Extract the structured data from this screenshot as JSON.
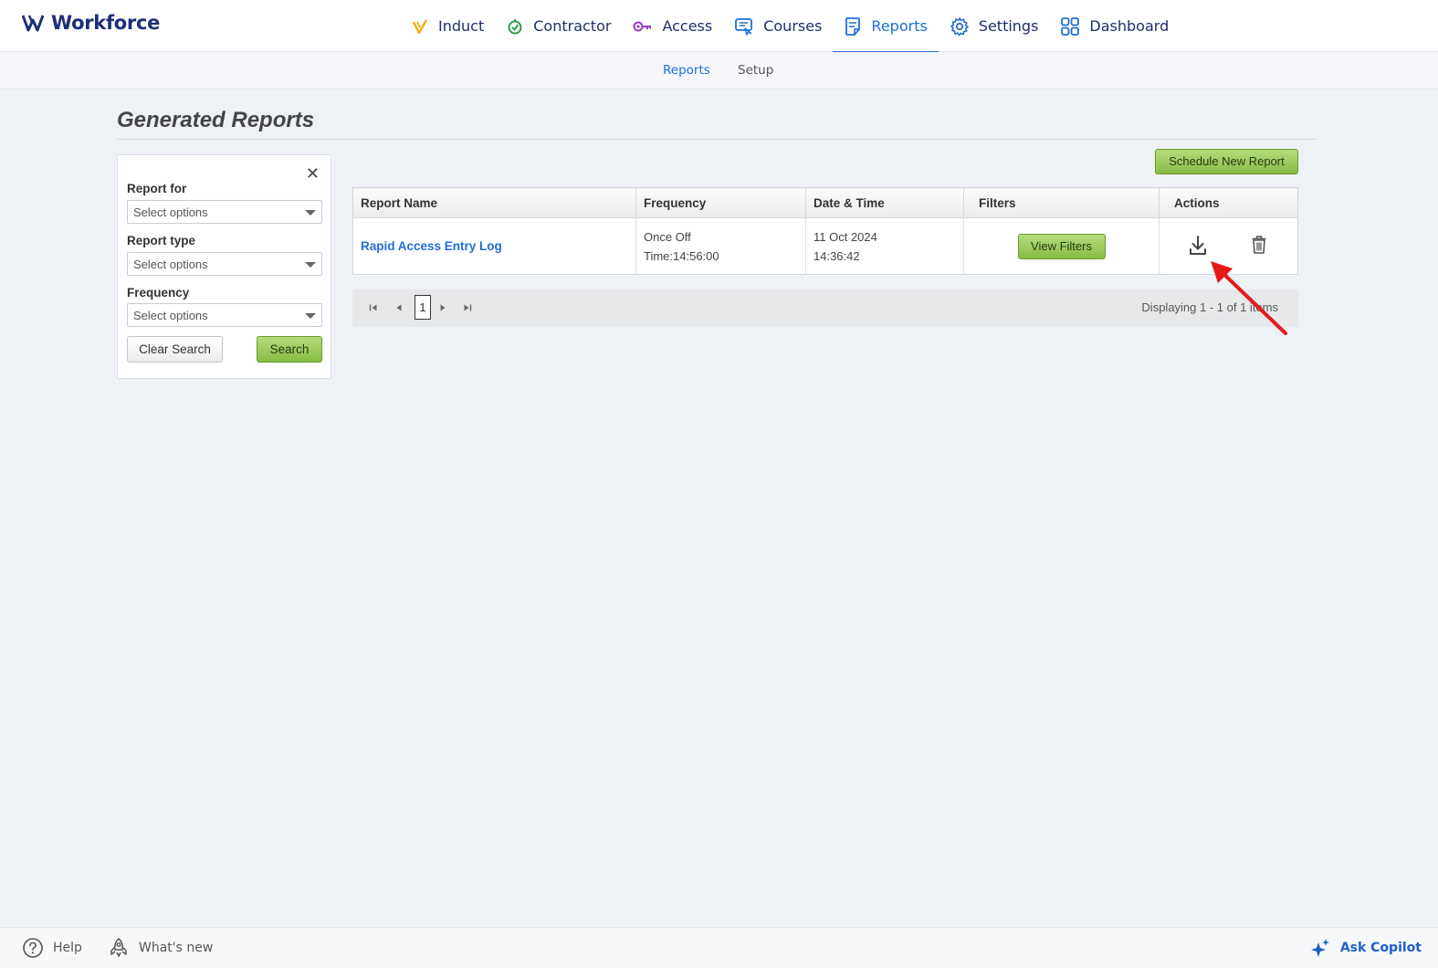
{
  "app": {
    "brand": "Workforce"
  },
  "nav": {
    "items": [
      {
        "label": "Induct",
        "icon": "induct-icon"
      },
      {
        "label": "Contractor",
        "icon": "contractor-icon"
      },
      {
        "label": "Access",
        "icon": "key-icon"
      },
      {
        "label": "Courses",
        "icon": "courses-icon"
      },
      {
        "label": "Reports",
        "icon": "reports-icon",
        "active": true
      },
      {
        "label": "Settings",
        "icon": "gear-icon"
      },
      {
        "label": "Dashboard",
        "icon": "dashboard-icon"
      }
    ]
  },
  "subnav": {
    "reports": "Reports",
    "setup": "Setup"
  },
  "page": {
    "title": "Generated Reports"
  },
  "filters": {
    "report_for_label": "Report for",
    "report_type_label": "Report type",
    "frequency_label": "Frequency",
    "placeholder": "Select options",
    "clear_label": "Clear Search",
    "search_label": "Search",
    "close": "✕"
  },
  "toolbar": {
    "schedule_label": "Schedule New Report"
  },
  "table": {
    "headers": [
      "Report Name",
      "Frequency",
      "Date & Time",
      "Filters",
      "Actions"
    ],
    "rows": [
      {
        "name": "Rapid Access Entry Log",
        "frequency_line1": "Once Off",
        "frequency_line2": "Time:14:56:00",
        "date": "11 Oct 2024",
        "time": "14:36:42",
        "filters_button": "View Filters"
      }
    ]
  },
  "pager": {
    "page": "1",
    "info": "Displaying 1 - 1 of 1 items"
  },
  "footer": {
    "help": "Help",
    "whats_new": "What's new",
    "copilot": "Ask Copilot"
  },
  "colors": {
    "accent": "#1f6ed4",
    "brand": "#1d2f7a",
    "button_green": "#8fc24e",
    "annotation_arrow": "#e51b1b"
  }
}
